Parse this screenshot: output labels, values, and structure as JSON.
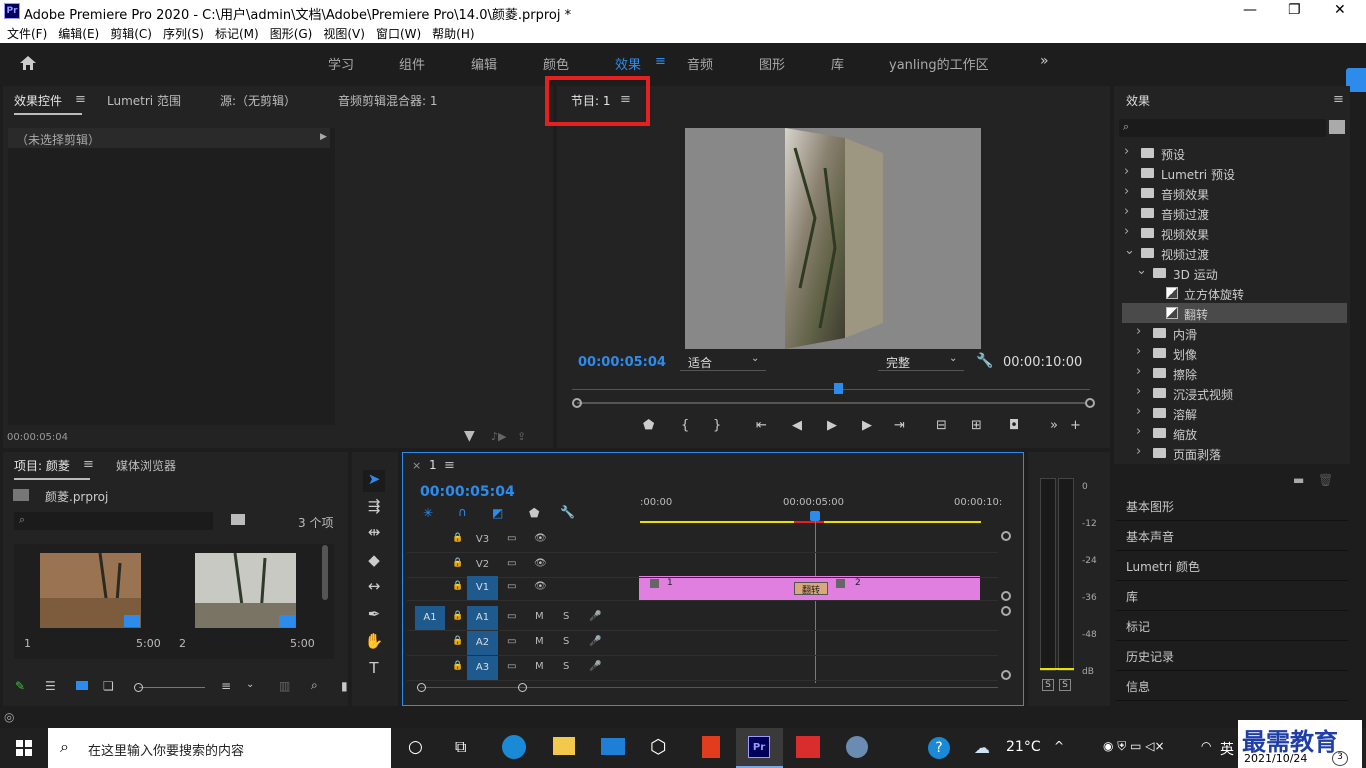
{
  "window": {
    "title": "Adobe Premiere Pro 2020 - C:\\用户\\admin\\文档\\Adobe\\Premiere Pro\\14.0\\颜菱.prproj *",
    "logo": "Pr"
  },
  "menu": [
    "文件(F)",
    "编辑(E)",
    "剪辑(C)",
    "序列(S)",
    "标记(M)",
    "图形(G)",
    "视图(V)",
    "窗口(W)",
    "帮助(H)"
  ],
  "workspaces": [
    "学习",
    "组件",
    "编辑",
    "颜色",
    "效果",
    "音频",
    "图形",
    "库",
    "yanling的工作区"
  ],
  "active_workspace": "效果",
  "source_panel": {
    "tabs": [
      "效果控件",
      "Lumetri 范围",
      "源:（无剪辑）",
      "音频剪辑混合器: 1"
    ],
    "no_clip": "（未选择剪辑）",
    "timecode": "00:00:05:04"
  },
  "program": {
    "tab": "节目: 1",
    "timecode": "00:00:05:04",
    "fit": "适合",
    "quality": "完整",
    "duration": "00:00:10:00"
  },
  "effects": {
    "title": "效果",
    "items": [
      {
        "label": "预设",
        "level": 0,
        "open": false,
        "kind": "star"
      },
      {
        "label": "Lumetri 预设",
        "level": 0,
        "open": false,
        "kind": "star"
      },
      {
        "label": "音频效果",
        "level": 0,
        "open": false,
        "kind": "folder"
      },
      {
        "label": "音频过渡",
        "level": 0,
        "open": false,
        "kind": "folder"
      },
      {
        "label": "视频效果",
        "level": 0,
        "open": false,
        "kind": "folder"
      },
      {
        "label": "视频过渡",
        "level": 0,
        "open": true,
        "kind": "folder"
      },
      {
        "label": "3D 运动",
        "level": 1,
        "open": true,
        "kind": "folder"
      },
      {
        "label": "立方体旋转",
        "level": 2,
        "kind": "fx"
      },
      {
        "label": "翻转",
        "level": 2,
        "kind": "fx",
        "selected": true
      },
      {
        "label": "内滑",
        "level": 1,
        "open": false,
        "kind": "folder"
      },
      {
        "label": "划像",
        "level": 1,
        "open": false,
        "kind": "folder"
      },
      {
        "label": "擦除",
        "level": 1,
        "open": false,
        "kind": "folder"
      },
      {
        "label": "沉浸式视频",
        "level": 1,
        "open": false,
        "kind": "folder"
      },
      {
        "label": "溶解",
        "level": 1,
        "open": false,
        "kind": "folder"
      },
      {
        "label": "缩放",
        "level": 1,
        "open": false,
        "kind": "folder"
      },
      {
        "label": "页面剥落",
        "level": 1,
        "open": false,
        "kind": "folder"
      }
    ]
  },
  "right_sections": [
    "基本图形",
    "基本声音",
    "Lumetri 颜色",
    "库",
    "标记",
    "历史记录",
    "信息"
  ],
  "project": {
    "tabs": [
      "项目: 颜菱",
      "媒体浏览器"
    ],
    "file": "颜菱.prproj",
    "count": "3 个项",
    "clips": [
      {
        "num": "1",
        "dur": "5:00"
      },
      {
        "num": "2",
        "dur": "5:00"
      }
    ]
  },
  "timeline": {
    "seq": "1",
    "timecode": "00:00:05:04",
    "ruler": [
      ":00:00",
      "00:00:05:00",
      "00:00:10:"
    ],
    "video_tracks": [
      "V3",
      "V2",
      "V1"
    ],
    "audio_tracks": [
      "A1",
      "A2",
      "A3"
    ],
    "source_patch": "A1",
    "clip1": "1",
    "clip2": "2",
    "transition": "翻转",
    "m": "M",
    "s": "S"
  },
  "meter": {
    "scale": [
      "0",
      "-12",
      "-24",
      "-36",
      "-48",
      "dB"
    ],
    "solo": [
      "S",
      "S"
    ]
  },
  "taskbar": {
    "search": "在这里输入你要搜索的内容",
    "temp": "21°C",
    "ime": "英",
    "date": "2021/10/24",
    "watermark": "最需教育",
    "badge": "3"
  },
  "colors": {
    "accent": "#2d8ceb",
    "clip": "#e07fe0",
    "highlight": "#e52020"
  }
}
